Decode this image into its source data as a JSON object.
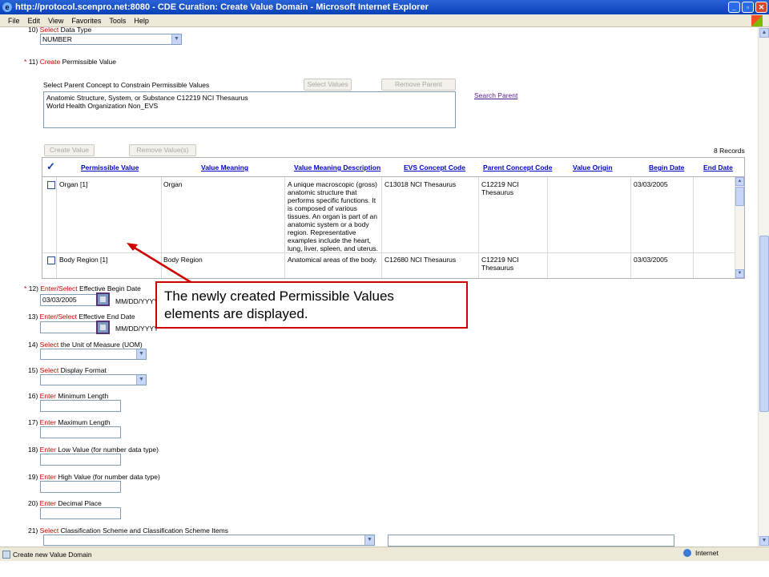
{
  "window": {
    "title": "http://protocol.scenpro.net:8080 - CDE Curation: Create Value Domain - Microsoft Internet Explorer"
  },
  "menu": [
    "File",
    "Edit",
    "View",
    "Favorites",
    "Tools",
    "Help"
  ],
  "form": {
    "item10": {
      "num": "10)",
      "action": "Select",
      "label": "Data Type",
      "value": "NUMBER"
    },
    "item11": {
      "num": "11)",
      "action": "Create",
      "label": "Permissible Value"
    },
    "parent": {
      "prompt": "Select Parent Concept to Constrain Permissible Values",
      "select_values": "Select Values",
      "remove_parent": "Remove Parent",
      "search_parent": "Search Parent",
      "lines": [
        "Anatomic Structure, System, or Substance C12219 NCI Thesaurus",
        "World Health Organization Non_EVS"
      ]
    },
    "create_value": "Create Value",
    "remove_values": "Remove Value(s)",
    "records": "8 Records",
    "table": {
      "headers": [
        "Permissible Value",
        "Value Meaning",
        "Value Meaning Description",
        "EVS Concept Code",
        "Parent Concept Code",
        "Value Origin",
        "Begin Date",
        "End Date"
      ],
      "rows": [
        {
          "pv": "Organ [1]",
          "vm": "Organ",
          "desc": "A unique macroscopic (gross) anatomic structure that performs specific functions. It is composed of various tissues. An organ is part of an anatomic system or a body region. Representative examples include the heart, lung, liver, spleen, and uterus.",
          "evs": "C13018 NCI Thesaurus",
          "parent": "C12219 NCI Thesaurus",
          "origin": "",
          "begin": "03/03/2005",
          "end": ""
        },
        {
          "pv": "Body Region [1]",
          "vm": "Body Region",
          "desc": "Anatomical areas of the body.",
          "evs": "C12680 NCI Thesaurus",
          "parent": "C12219 NCI Thesaurus",
          "origin": "",
          "begin": "03/03/2005",
          "end": ""
        }
      ]
    },
    "item12": {
      "num": "12)",
      "action": "Enter/Select",
      "label": "Effective Begin Date",
      "value": "03/03/2005",
      "format": "MM/DD/YYYY"
    },
    "item13": {
      "num": "13)",
      "action": "Enter/Select",
      "label": "Effective End Date",
      "value": "",
      "format": "MM/DD/YYYY"
    },
    "item14": {
      "num": "14)",
      "action": "Select",
      "label": "the Unit of Measure (UOM)"
    },
    "item15": {
      "num": "15)",
      "action": "Select",
      "label": "Display Format"
    },
    "item16": {
      "num": "16)",
      "action": "Enter",
      "label": "Minimum Length"
    },
    "item17": {
      "num": "17)",
      "action": "Enter",
      "label": "Maximum Length"
    },
    "item18": {
      "num": "18)",
      "action": "Enter",
      "label": "Low Value (for number data type)"
    },
    "item19": {
      "num": "19)",
      "action": "Enter",
      "label": "High Value (for number data type)"
    },
    "item20": {
      "num": "20)",
      "action": "Enter",
      "label": "Decimal Place"
    },
    "item21": {
      "num": "21)",
      "action": "Select",
      "label": "Classification Scheme and Classification Scheme Items"
    }
  },
  "callout": {
    "line1": "The newly created Permissible Values",
    "line2": "elements are displayed."
  },
  "status": {
    "text": "Create new Value Domain",
    "zone": "Internet"
  },
  "colors": {
    "required": "#cc0000",
    "callout_border": "#cc0000",
    "link": "#0000cc"
  }
}
